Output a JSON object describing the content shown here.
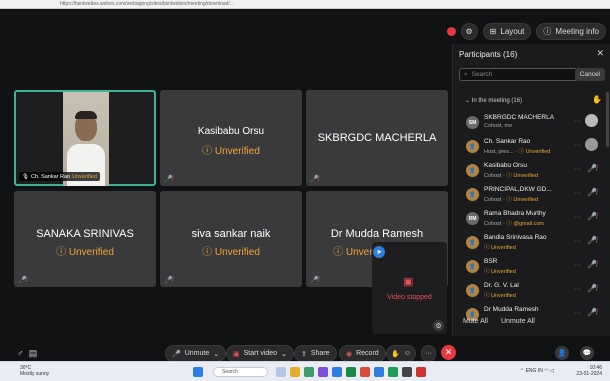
{
  "browser": {
    "url": "https://bsnlwebex.webex.com/webappng/sites/bsnlwebex/meeting/download/..."
  },
  "top_controls": {
    "layout": "Layout",
    "meeting_info": "Meeting info"
  },
  "tiles": [
    {
      "name": "Ch. Sankar Rao",
      "status": "Unverified",
      "has_video": true
    },
    {
      "name": "Kasibabu Orsu",
      "status": "Unverified"
    },
    {
      "name": "SKBRGDC MACHERLA",
      "status": ""
    },
    {
      "name": "SANAKA SRINIVAS",
      "status": "Unverified"
    },
    {
      "name": "siva sankar naik",
      "status": "Unverified"
    },
    {
      "name": "Dr Mudda Ramesh",
      "status": "Unverified"
    }
  ],
  "video_stopped": {
    "text": "Video stopped"
  },
  "participants": {
    "title": "Participants (16)",
    "search_placeholder": "Search",
    "cancel": "Cancel",
    "in_meeting": "In the meeting (16)",
    "list": [
      {
        "name": "SKBRGDC MACHERLA",
        "sub": "Cohost, me",
        "initials": "SM",
        "unverified": false
      },
      {
        "name": "Ch. Sankar Rao",
        "sub": "Host, pres...",
        "sub2": "Unverified",
        "initials": "",
        "unverified": true
      },
      {
        "name": "Kasibabu Orsu",
        "sub": "Cohost",
        "sub2": "Unverified",
        "initials": "",
        "unverified": true
      },
      {
        "name": "PRINCIPAL,DKW GD...",
        "sub": "Cohost",
        "sub2": "Unverified",
        "initials": "",
        "unverified": true
      },
      {
        "name": "Rama Bhadra Murthy",
        "sub": "Cohost",
        "sub2": "@gmail.com",
        "initials": "RM",
        "unverified": false
      },
      {
        "name": "Bandla Srinivasa Rao",
        "sub": "",
        "sub2": "Unverified",
        "initials": "",
        "unverified": true
      },
      {
        "name": "BSR",
        "sub": "",
        "sub2": "Unverified",
        "initials": "",
        "unverified": true
      },
      {
        "name": "Dr. G. V. Lal",
        "sub": "",
        "sub2": "Unverified",
        "initials": "",
        "unverified": true
      },
      {
        "name": "Dr Mudda Ramesh",
        "sub": "",
        "sub2": "",
        "initials": "",
        "unverified": false
      }
    ],
    "mute_all": "Mute All",
    "unmute_all": "Unmute All"
  },
  "bottom": {
    "unmute": "Unmute",
    "start_video": "Start video",
    "share": "Share",
    "record": "Record"
  },
  "taskbar": {
    "temp": "30°C",
    "weather": "Mostly sunny",
    "search": "Search",
    "lang": "ENG\nIN",
    "time": "10:46",
    "date": "23-01-2024"
  }
}
